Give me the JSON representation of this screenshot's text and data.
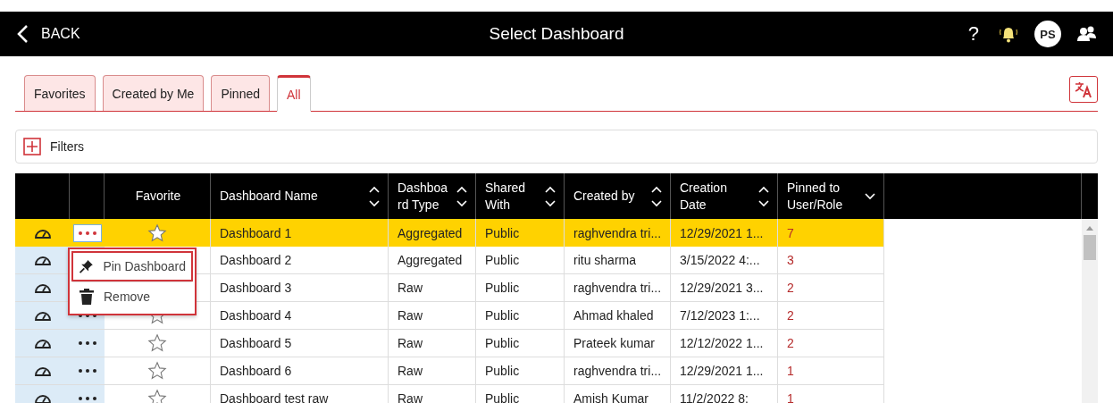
{
  "header": {
    "back": "BACK",
    "title": "Select Dashboard",
    "help": "?",
    "avatar": "PS"
  },
  "tabs": [
    {
      "label": "Favorites",
      "selected": false
    },
    {
      "label": "Created by Me",
      "selected": false
    },
    {
      "label": "Pinned",
      "selected": false
    },
    {
      "label": "All",
      "selected": true
    }
  ],
  "filters": {
    "label": "Filters"
  },
  "table": {
    "favorite_column": {
      "label": "Favorite"
    },
    "columns": [
      {
        "label": "Dashboard Name",
        "sort_up": true,
        "sort_down": true
      },
      {
        "label": "Dashboa rd Type",
        "sort_up": true,
        "sort_down": true
      },
      {
        "label": "Shared With",
        "sort_up": true,
        "sort_down": true
      },
      {
        "label": "Created by",
        "sort_up": true,
        "sort_down": true
      },
      {
        "label": "Creation Date",
        "sort_up": true,
        "sort_down": true
      },
      {
        "label": "Pinned to User/Role",
        "sort_up": false,
        "sort_down": true
      }
    ],
    "rows": [
      {
        "selected": true,
        "favorite": false,
        "cells": [
          "Dashboard 1",
          "Aggregated",
          "Public",
          "raghvendra tri...",
          "12/29/2021 1...",
          "7"
        ]
      },
      {
        "selected": false,
        "cells": [
          "Dashboard 2",
          "Aggregated",
          "Public",
          "ritu sharma",
          "3/15/2022 4:...",
          "3"
        ]
      },
      {
        "selected": false,
        "cells": [
          "Dashboard 3",
          "Raw",
          "Public",
          "raghvendra tri...",
          "12/29/2021 3...",
          "2"
        ]
      },
      {
        "selected": false,
        "favorite": false,
        "cells": [
          "Dashboard 4",
          "Raw",
          "Public",
          "Ahmad khaled",
          "7/12/2023 1:...",
          "2"
        ]
      },
      {
        "selected": false,
        "favorite": false,
        "cells": [
          "Dashboard 5",
          "Raw",
          "Public",
          "Prateek kumar",
          "12/12/2022 1...",
          "2"
        ]
      },
      {
        "selected": false,
        "favorite": false,
        "cells": [
          "Dashboard 6",
          "Raw",
          "Public",
          "raghvendra tri...",
          "12/29/2021 1...",
          "1"
        ]
      },
      {
        "selected": false,
        "favorite": false,
        "cells": [
          "Dashboard test raw",
          "Raw",
          "Public",
          "Amish Kumar",
          "11/2/2022 8:",
          "1"
        ]
      }
    ]
  },
  "context_menu": {
    "items": [
      {
        "kind": "pin",
        "label": "Pin Dashboard",
        "selected": true
      },
      {
        "kind": "remove",
        "label": "Remove",
        "selected": false
      }
    ]
  }
}
